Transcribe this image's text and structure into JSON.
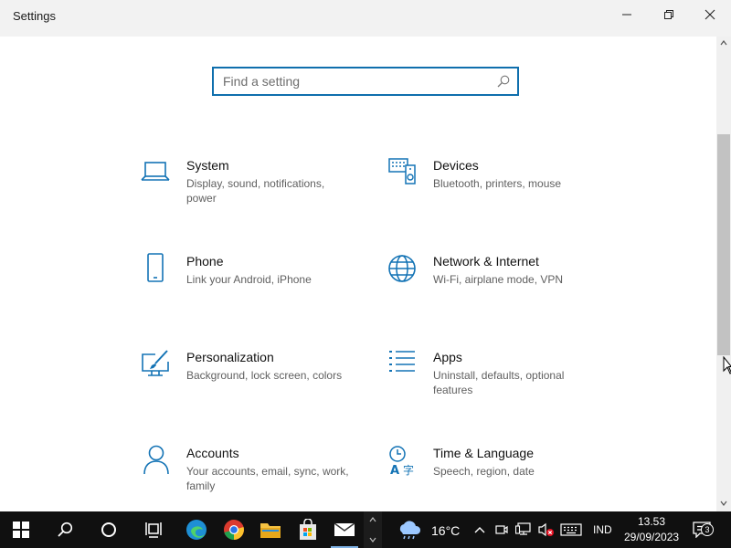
{
  "window": {
    "title": "Settings",
    "controls": {
      "minimize": "minimize",
      "restore": "restore",
      "close": "close"
    }
  },
  "search": {
    "placeholder": "Find a setting",
    "value": ""
  },
  "tiles": [
    {
      "name": "System",
      "description": "Display, sound, notifications, power",
      "icon": "laptop-icon"
    },
    {
      "name": "Devices",
      "description": "Bluetooth, printers, mouse",
      "icon": "keyboard-speaker-icon"
    },
    {
      "name": "Phone",
      "description": "Link your Android, iPhone",
      "icon": "phone-icon"
    },
    {
      "name": "Network & Internet",
      "description": "Wi-Fi, airplane mode, VPN",
      "icon": "globe-icon"
    },
    {
      "name": "Personalization",
      "description": "Background, lock screen, colors",
      "icon": "paint-screen-icon"
    },
    {
      "name": "Apps",
      "description": "Uninstall, defaults, optional features",
      "icon": "list-icon"
    },
    {
      "name": "Accounts",
      "description": "Your accounts, email, sync, work, family",
      "icon": "person-icon"
    },
    {
      "name": "Time & Language",
      "description": "Speech, region, date",
      "icon": "time-language-icon"
    }
  ],
  "taskbar": {
    "pinned": [
      "start",
      "search",
      "cortana",
      "task-view",
      "edge",
      "chrome",
      "file-explorer",
      "store",
      "mail"
    ],
    "weather": {
      "temperature": "16°C"
    },
    "language": "IND",
    "clock": {
      "time": "13.53",
      "date": "29/09/2023"
    },
    "notifications_count": "3"
  },
  "colors": {
    "accent": "#0f6fad",
    "icon_blue": "#1373b5",
    "taskbar": "#101010"
  }
}
